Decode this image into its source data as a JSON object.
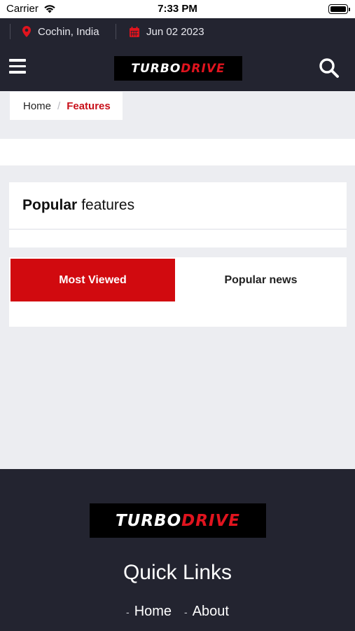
{
  "status_bar": {
    "carrier": "Carrier",
    "time": "7:33 PM"
  },
  "info_bar": {
    "location": "Cochin, India",
    "date": "Jun 02 2023",
    "accent_color": "#e0141e"
  },
  "logo": {
    "part1": "TURBO",
    "part2": "DRIVE"
  },
  "breadcrumb": {
    "home": "Home",
    "separator": "/",
    "current": "Features"
  },
  "features": {
    "title_bold": "Popular",
    "title_rest": "features"
  },
  "tabs": [
    {
      "label": "Most Viewed",
      "active": true
    },
    {
      "label": "Popular news",
      "active": false
    }
  ],
  "footer": {
    "quick_links_title": "Quick Links",
    "links": [
      {
        "dash": "-",
        "label": "Home"
      },
      {
        "dash": "-",
        "label": "About"
      }
    ]
  },
  "icons": {
    "menu": "hamburger-menu-icon",
    "search": "search-icon",
    "location": "map-pin-icon",
    "date": "calendar-icon"
  }
}
